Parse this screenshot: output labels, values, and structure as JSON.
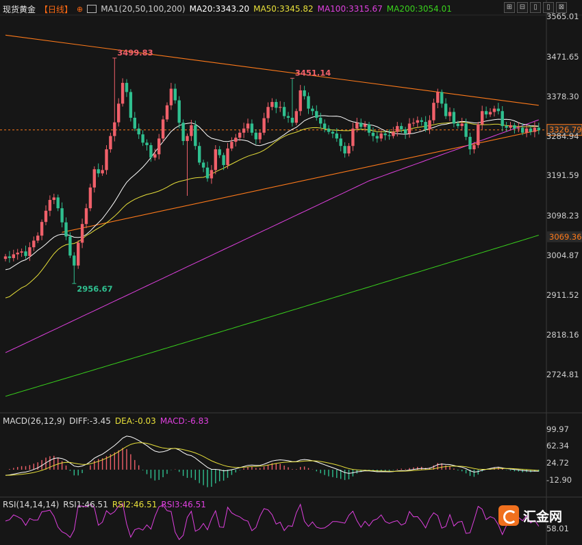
{
  "header": {
    "symbol": "现货黄金",
    "period": "【日线】",
    "ma_label": "MA1(20,50,100,200)",
    "ma20": "MA20:3343.20",
    "ma50": "MA50:3345.82",
    "ma100": "MA100:3315.67",
    "ma200": "MA200:3054.01"
  },
  "toolbar": {
    "buttons": [
      "⊞",
      "⊟",
      "▯",
      "▯",
      "⊠"
    ]
  },
  "colors": {
    "up": "#f0606a",
    "down": "#2fbf8f",
    "ma20": "#ffffff",
    "ma50": "#e8e03a",
    "ma100": "#e040e0",
    "ma200": "#39d31c",
    "trend": "#ff7a1a",
    "bg": "#161616"
  },
  "price_axis": {
    "ticks": [
      "3565.01",
      "3471.65",
      "3378.30",
      "3284.94",
      "3191.59",
      "3098.23",
      "3004.87",
      "2911.52",
      "2818.16",
      "2724.81"
    ],
    "current": "3326.79",
    "ma200_tag": "3069.36"
  },
  "annotations": {
    "high1": "3499.83",
    "high2": "3451.14",
    "low1": "2956.67"
  },
  "macd": {
    "label": "MACD(26,12,9)",
    "diff": "DIFF:-3.45",
    "dea": "DEA:-0.03",
    "macd": "MACD:-6.83",
    "ticks": [
      "99.97",
      "62.34",
      "24.72",
      "-12.90"
    ]
  },
  "rsi": {
    "label": "RSI(14,14,14)",
    "rsi1": "RSI1:46.51",
    "rsi2": "RSI2:46.51",
    "rsi3": "RSI3:46.51",
    "tick": "58.01"
  },
  "logo": {
    "text": "汇金网"
  },
  "chart_data": {
    "type": "candlestick",
    "panels": [
      "price",
      "macd",
      "rsi"
    ],
    "price_ylim": [
      2650,
      3610
    ],
    "series": [
      {
        "name": "MA20",
        "color": "#ffffff"
      },
      {
        "name": "MA50",
        "color": "#e8e03a"
      },
      {
        "name": "MA100",
        "color": "#e040e0"
      },
      {
        "name": "MA200",
        "color": "#39d31c"
      }
    ],
    "current_price": 3326.79,
    "trendlines": [
      {
        "from": [
          0,
          3555
        ],
        "to": [
          132,
          3386
        ]
      },
      {
        "from": [
          14,
          3080
        ],
        "to": [
          132,
          3326
        ]
      }
    ],
    "closes": [
      3022,
      3018,
      3027,
      3031,
      3034,
      3023,
      3044,
      3060,
      3072,
      3105,
      3132,
      3158,
      3164,
      3138,
      3104,
      3070,
      3024,
      3000,
      3055,
      3100,
      3138,
      3188,
      3232,
      3222,
      3230,
      3280,
      3312,
      3345,
      3390,
      3440,
      3418,
      3356,
      3330,
      3316,
      3296,
      3290,
      3260,
      3268,
      3306,
      3352,
      3386,
      3426,
      3398,
      3344,
      3300,
      3312,
      3338,
      3288,
      3248,
      3236,
      3210,
      3230,
      3280,
      3266,
      3242,
      3282,
      3298,
      3308,
      3320,
      3330,
      3342,
      3320,
      3304,
      3320,
      3355,
      3382,
      3394,
      3380,
      3382,
      3360,
      3356,
      3344,
      3372,
      3422,
      3408,
      3378,
      3372,
      3356,
      3342,
      3330,
      3322,
      3318,
      3306,
      3288,
      3270,
      3288,
      3330,
      3344,
      3334,
      3340,
      3320,
      3312,
      3306,
      3318,
      3314,
      3312,
      3322,
      3336,
      3328,
      3318,
      3342,
      3344,
      3350,
      3346,
      3328,
      3350,
      3392,
      3418,
      3390,
      3360,
      3370,
      3342,
      3336,
      3342,
      3310,
      3280,
      3290,
      3340,
      3372,
      3364,
      3370,
      3378,
      3372,
      3336,
      3332,
      3338,
      3330,
      3332,
      3320,
      3330,
      3322,
      3332,
      3326
    ]
  }
}
